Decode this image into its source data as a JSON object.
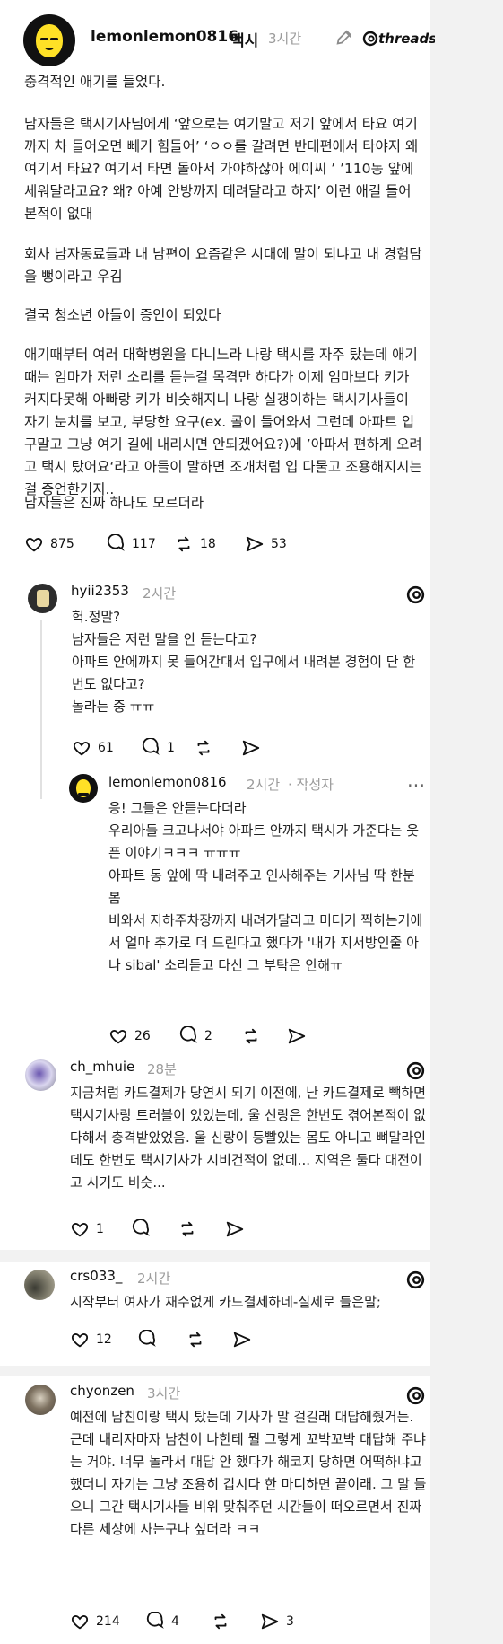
{
  "header": {
    "username": "lemonlemon0816",
    "category": "택시",
    "time": "3시간",
    "brand": "threads"
  },
  "main_post": {
    "paragraphs": [
      "충격적인 애기를 들었다.",
      "남자들은 택시기사님에게 ‘앞으로는 여기말고 저기 앞에서 타요 여기까지 차 들어오면 빼기 힘들어’ ‘ㅇㅇ를 갈려면 반대편에서 타야지 왜 여기서 타요? 여기서 타면 돌아서 가야하잖아 에이씨 ’ ’110동 앞에 세워달라고요? 왜? 아예 안방까지 데려달라고 하지’ 이런 애길 들어본적이 없대",
      "회사 남자동료들과 내 남편이 요즘같은 시대에 말이 되냐고 내 경험담을 뻥이라고 우김",
      "결국 청소년 아들이 증인이 되었다",
      "애기때부터 여러 대학병원을 다니느라 나랑 택시를 자주 탔는데 애기때는 엄마가 저런 소리를 듣는걸 목격만 하다가 이제 엄마보다 키가 커지다못해 아빠랑 키가 비슷해지니 나랑 실갱이하는 택시기사들이 자기 눈치를 보고, 부당한 요구(ex. 콜이 들어와서 그런데 아파트 입구말고 그냥 여기 길에 내리시면 안되겠어요?)에 ’아파서 편하게 오려고 택시 탔어요‘라고 아들이 말하면 조개처럼 입 다물고 조용해지시는걸 증언한거지..",
      "남자들은 진짜 하나도 모르더라"
    ],
    "actions": {
      "likes": "875",
      "comments": "117",
      "reposts": "18",
      "shares": "53"
    }
  },
  "comments": [
    {
      "username": "hyii2353",
      "time": "2시간",
      "text": "헉.정말?\n남자들은 저런 말을 안 듣는다고?\n아파트 안에까지 못 들어간대서 입구에서 내려본 경험이 단 한 번도 없다고?\n놀라는 중 ㅠㅠ",
      "likes": "61",
      "comments": "1"
    },
    {
      "username": "lemonlemon0816",
      "time": "2시간",
      "role": "· 작성자",
      "text": "응! 그들은 안듣는다더라\n우리아들 크고나서야 아파트 안까지 택시가 가준다는 웃픈 이야기ㅋㅋㅋ ㅠㅠㅠ\n아파트 동 앞에 딱 내려주고 인사해주는 기사님 딱 한분 봄\n비와서 지하주차장까지 내려가달라고 미터기 찍히는거에서 얼마 추가로 더 드린다고 했다가 '내가 지서방인줄 아나 sibal' 소리듣고 다신 그 부탁은 안해ㅠ",
      "likes": "26",
      "comments": "2",
      "more": "..."
    },
    {
      "username": "ch_mhuie",
      "time": "28분",
      "text": "지금처럼 카드결제가 당연시 되기 이전에, 난 카드결제로 빽하면 택시기사랑 트러블이 있었는데, 울 신랑은 한번도 겪어본적이 없다해서 충격받았었음. 울 신랑이 등빨있는 몸도 아니고 뼈말라인데도 한번도 택시기사가 시비건적이 없데... 지역은 둘다 대전이고 시기도 비슷...",
      "likes": "1"
    },
    {
      "username": "crs033_",
      "time": "2시간",
      "text": "시작부터 여자가 재수없게 카드결제하네-실제로 들은말;",
      "likes": "12"
    },
    {
      "username": "chyonzen",
      "time": "3시간",
      "text": "예전에 남친이랑 택시 탔는데 기사가 말 걸길래 대답해줬거든. 근데 내리자마자 남친이 나한테 뭘 그렇게 꼬박꼬박 대답해 주냐는 거야. 너무 놀라서 대답 안 했다가 해코지 당하면 어떡하냐고 했더니 자기는 그냥 조용히 갑시다 한 마디하면 끝이래. 그 말 들으니 그간 택시기사들 비위 맞춰주던 시간들이 떠오르면서 진짜 다른 세상에 사는구나 싶더라 ㅋㅋ",
      "likes": "214",
      "comments": "4",
      "shares": "3"
    }
  ],
  "colors": {
    "background": "#f2f2f2",
    "card": "#ffffff",
    "muted": "#9b9b9b",
    "text": "#111111",
    "line": "#e1e1e1"
  },
  "icons": [
    "pencil-icon",
    "threads-logo-icon",
    "heart-icon",
    "comment-icon",
    "repost-icon",
    "share-icon",
    "more-icon"
  ]
}
